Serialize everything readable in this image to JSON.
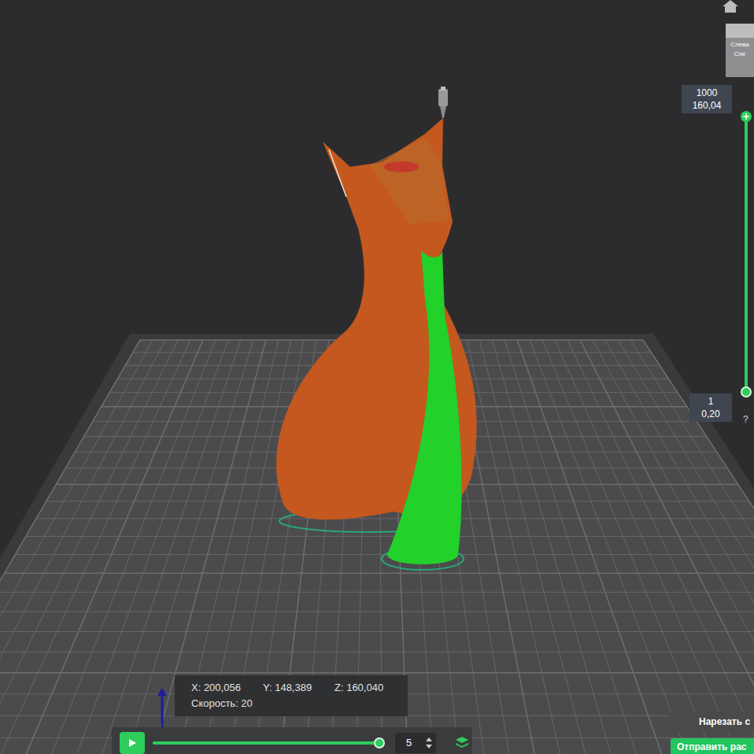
{
  "viewport": {
    "view_cube": {
      "labels": [
        "Слева",
        "Спе"
      ]
    }
  },
  "layer_slider": {
    "top": {
      "layer": "1000",
      "height": "160,04"
    },
    "bottom": {
      "layer": "1",
      "height": "0,20"
    },
    "level": 1,
    "help": "?"
  },
  "position_info": {
    "x": "X: 200,056",
    "y": "Y: 148,389",
    "z": "Z: 160,040",
    "speed": "Скорость: 20"
  },
  "playback": {
    "level": 1,
    "speed": "5"
  },
  "buttons": [
    {
      "label": "Нарезать с",
      "kind": "secondary"
    },
    {
      "label": "Отправить рас",
      "kind": "primary"
    }
  ]
}
